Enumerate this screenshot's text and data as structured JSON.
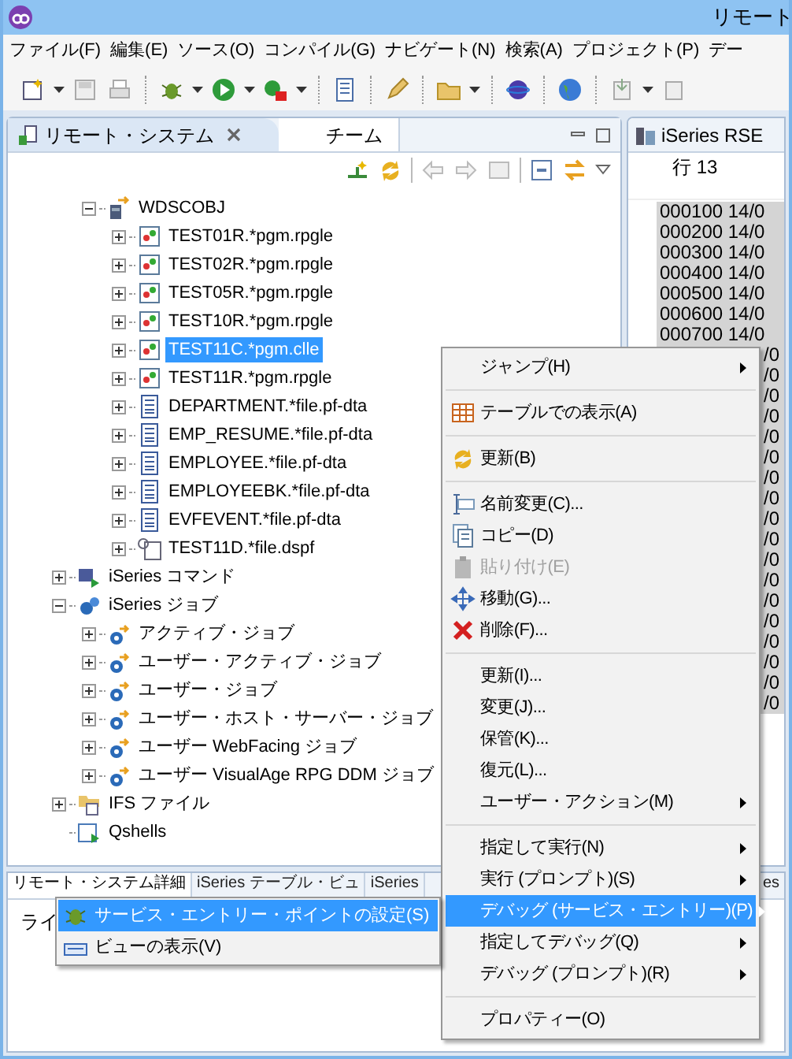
{
  "window": {
    "title": "リモート"
  },
  "menubar": [
    "ファイル(F)",
    "編集(E)",
    "ソース(O)",
    "コンパイル(G)",
    "ナビゲート(N)",
    "検索(A)",
    "プロジェクト(P)",
    "デー"
  ],
  "left_panel": {
    "tabs": [
      {
        "label": "リモート・システム",
        "selected": true,
        "closable": true
      },
      {
        "label": "チーム",
        "selected": false,
        "closable": false
      }
    ]
  },
  "tree": {
    "scrolled_branch": {
      "label": "WDSCOBJ",
      "kind": "library",
      "expandable": true,
      "expanded": true,
      "selected": false,
      "children": [
        {
          "label": "TEST01R.*pgm.rpgle",
          "kind": "program",
          "expandable": true,
          "expanded": false,
          "selected": false
        },
        {
          "label": "TEST02R.*pgm.rpgle",
          "kind": "program",
          "expandable": true,
          "expanded": false,
          "selected": false
        },
        {
          "label": "TEST05R.*pgm.rpgle",
          "kind": "program",
          "expandable": true,
          "expanded": false,
          "selected": false
        },
        {
          "label": "TEST10R.*pgm.rpgle",
          "kind": "program",
          "expandable": true,
          "expanded": false,
          "selected": false
        },
        {
          "label": "TEST11C.*pgm.clle",
          "kind": "program",
          "expandable": true,
          "expanded": false,
          "selected": true
        },
        {
          "label": "TEST11R.*pgm.rpgle",
          "kind": "program",
          "expandable": true,
          "expanded": false,
          "selected": false
        },
        {
          "label": "DEPARTMENT.*file.pf-dta",
          "kind": "file",
          "expandable": true,
          "expanded": false,
          "selected": false
        },
        {
          "label": "EMP_RESUME.*file.pf-dta",
          "kind": "file",
          "expandable": true,
          "expanded": false,
          "selected": false
        },
        {
          "label": "EMPLOYEE.*file.pf-dta",
          "kind": "file",
          "expandable": true,
          "expanded": false,
          "selected": false
        },
        {
          "label": "EMPLOYEEBK.*file.pf-dta",
          "kind": "file",
          "expandable": true,
          "expanded": false,
          "selected": false
        },
        {
          "label": "EVFEVENT.*file.pf-dta",
          "kind": "file",
          "expandable": true,
          "expanded": false,
          "selected": false
        },
        {
          "label": "TEST11D.*file.dspf",
          "kind": "dspf",
          "expandable": true,
          "expanded": false,
          "selected": false
        }
      ]
    },
    "items": [
      {
        "label": "iSeries コマンド",
        "kind": "commands",
        "expandable": true,
        "expanded": false,
        "selected": false
      },
      {
        "label": "iSeries ジョブ",
        "kind": "jobs",
        "expandable": true,
        "expanded": true,
        "selected": false,
        "children": [
          {
            "label": "アクティブ・ジョブ",
            "kind": "job",
            "expandable": true,
            "expanded": false,
            "selected": false
          },
          {
            "label": "ユーザー・アクティブ・ジョブ",
            "kind": "job",
            "expandable": true,
            "expanded": false,
            "selected": false
          },
          {
            "label": "ユーザー・ジョブ",
            "kind": "job",
            "expandable": true,
            "expanded": false,
            "selected": false
          },
          {
            "label": "ユーザー・ホスト・サーバー・ジョブ",
            "kind": "job",
            "expandable": true,
            "expanded": false,
            "selected": false
          },
          {
            "label": "ユーザー WebFacing ジョブ",
            "kind": "job",
            "expandable": true,
            "expanded": false,
            "selected": false
          },
          {
            "label": "ユーザー VisualAge RPG DDM ジョブ",
            "kind": "job",
            "expandable": true,
            "expanded": false,
            "selected": false
          }
        ]
      },
      {
        "label": "IFS ファイル",
        "kind": "ifs",
        "expandable": true,
        "expanded": false,
        "selected": false
      },
      {
        "label": "Qshells",
        "kind": "qshell",
        "expandable": false,
        "selected": false
      }
    ]
  },
  "editor": {
    "tab": "iSeries RSE",
    "position": "行 13",
    "lines": [
      {
        "text": "000100 14/0",
        "kind": "full"
      },
      {
        "text": "000200 14/0",
        "kind": "full"
      },
      {
        "text": "000300 14/0",
        "kind": "full"
      },
      {
        "text": "000400 14/0",
        "kind": "full"
      },
      {
        "text": "000500 14/0",
        "kind": "full"
      },
      {
        "text": "000600 14/0",
        "kind": "full"
      },
      {
        "text": "000700 14/0",
        "kind": "full"
      },
      {
        "text": "/0",
        "kind": "partial"
      },
      {
        "text": "/0",
        "kind": "partial"
      },
      {
        "text": "/0",
        "kind": "partial"
      },
      {
        "text": "/0",
        "kind": "partial"
      },
      {
        "text": "/0",
        "kind": "partial"
      },
      {
        "text": "/0",
        "kind": "partial"
      },
      {
        "text": "/0",
        "kind": "partial"
      },
      {
        "text": "/0",
        "kind": "partial"
      },
      {
        "text": "/0",
        "kind": "partial"
      },
      {
        "text": "/0",
        "kind": "partial"
      },
      {
        "text": "/0",
        "kind": "partial"
      },
      {
        "text": "/0",
        "kind": "partial"
      },
      {
        "text": "/0",
        "kind": "partial"
      },
      {
        "text": "/0",
        "kind": "partial"
      },
      {
        "text": "/0",
        "kind": "partial"
      },
      {
        "text": "/0",
        "kind": "partial"
      },
      {
        "text": "/0",
        "kind": "partial"
      },
      {
        "text": "/0",
        "kind": "partial"
      }
    ]
  },
  "bottom_panel": {
    "tabs": [
      {
        "label": "リモート・システム詳細",
        "selected": true
      },
      {
        "label": "iSeries テーブル・ビュ",
        "selected": false
      },
      {
        "label": "iSeries",
        "selected": false
      },
      {
        "label": "es",
        "selected": false
      }
    ],
    "cell": "ライ"
  },
  "context_menu": [
    {
      "kind": "item",
      "label": "ジャンプ(H)",
      "submenu": true,
      "disabled": false,
      "selected": false
    },
    {
      "kind": "separator"
    },
    {
      "kind": "item",
      "label": "テーブルでの表示(A)",
      "submenu": false,
      "disabled": false,
      "selected": false
    },
    {
      "kind": "separator"
    },
    {
      "kind": "item",
      "label": "更新(B)",
      "submenu": false,
      "disabled": false,
      "selected": false
    },
    {
      "kind": "separator"
    },
    {
      "kind": "item",
      "label": "名前変更(C)...",
      "submenu": false,
      "disabled": false,
      "selected": false
    },
    {
      "kind": "item",
      "label": "コピー(D)",
      "submenu": false,
      "disabled": false,
      "selected": false
    },
    {
      "kind": "item",
      "label": "貼り付け(E)",
      "submenu": false,
      "disabled": true,
      "selected": false
    },
    {
      "kind": "item",
      "label": "移動(G)...",
      "submenu": false,
      "disabled": false,
      "selected": false
    },
    {
      "kind": "item",
      "label": "削除(F)...",
      "submenu": false,
      "disabled": false,
      "selected": false
    },
    {
      "kind": "separator"
    },
    {
      "kind": "item",
      "label": "更新(I)...",
      "submenu": false,
      "disabled": false,
      "selected": false
    },
    {
      "kind": "item",
      "label": "変更(J)...",
      "submenu": false,
      "disabled": false,
      "selected": false
    },
    {
      "kind": "item",
      "label": "保管(K)...",
      "submenu": false,
      "disabled": false,
      "selected": false
    },
    {
      "kind": "item",
      "label": "復元(L)...",
      "submenu": false,
      "disabled": false,
      "selected": false
    },
    {
      "kind": "item",
      "label": "ユーザー・アクション(M)",
      "submenu": true,
      "disabled": false,
      "selected": false
    },
    {
      "kind": "separator"
    },
    {
      "kind": "item",
      "label": "指定して実行(N)",
      "submenu": true,
      "disabled": false,
      "selected": false
    },
    {
      "kind": "item",
      "label": "実行 (プロンプト)(S)",
      "submenu": true,
      "disabled": false,
      "selected": false
    },
    {
      "kind": "item",
      "label": "デバッグ (サービス・エントリー)(P)",
      "submenu": true,
      "disabled": false,
      "selected": true
    },
    {
      "kind": "item",
      "label": "指定してデバッグ(Q)",
      "submenu": true,
      "disabled": false,
      "selected": false
    },
    {
      "kind": "item",
      "label": "デバッグ (プロンプト)(R)",
      "submenu": true,
      "disabled": false,
      "selected": false
    },
    {
      "kind": "separator"
    },
    {
      "kind": "item",
      "label": "プロパティー(O)",
      "submenu": false,
      "disabled": false,
      "selected": false
    }
  ],
  "submenu": [
    {
      "label": "サービス・エントリー・ポイントの設定(S)",
      "selected": true
    },
    {
      "label": "ビューの表示(V)",
      "selected": false
    }
  ]
}
